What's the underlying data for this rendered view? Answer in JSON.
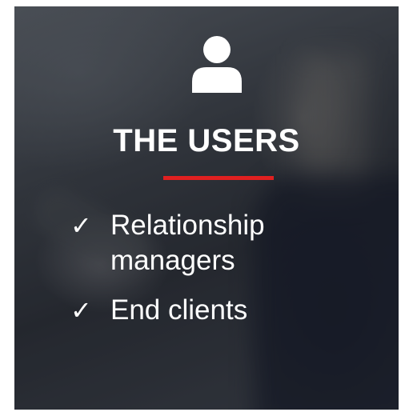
{
  "card": {
    "icon": "user-icon",
    "title": "THE USERS",
    "accent_color": "#e02020",
    "items": [
      {
        "icon": "check-icon",
        "check": "✓",
        "label": "Relationship managers"
      },
      {
        "icon": "check-icon",
        "check": "✓",
        "label": "End clients"
      }
    ]
  }
}
